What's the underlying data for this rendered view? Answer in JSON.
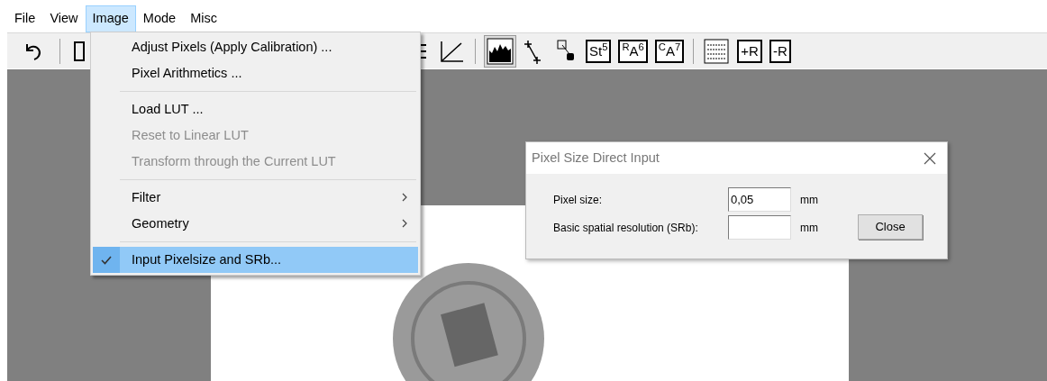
{
  "menu_bar": [
    {
      "label": "File",
      "selected": false
    },
    {
      "label": "View",
      "selected": false
    },
    {
      "label": "Image",
      "selected": true
    },
    {
      "label": "Mode",
      "selected": false
    },
    {
      "label": "Misc",
      "selected": false
    }
  ],
  "toolbar": [
    {
      "kind": "undo",
      "pressed": false
    },
    {
      "kind": "sep"
    },
    {
      "kind": "frame",
      "pressed": false
    },
    {
      "kind": "levels",
      "pressed": false
    },
    {
      "kind": "diagonal",
      "pressed": false
    },
    {
      "kind": "sep"
    },
    {
      "kind": "histogram",
      "pressed": true
    },
    {
      "kind": "measure",
      "pressed": false
    },
    {
      "kind": "point",
      "pressed": false
    },
    {
      "kind": "text",
      "label": "St$^{5}$",
      "pressed": false
    },
    {
      "kind": "text",
      "label": "$^{R}$A$^{6}$",
      "pressed": false
    },
    {
      "kind": "text",
      "label": "$^{C}$A$^{7}$",
      "pressed": false
    },
    {
      "kind": "sep"
    },
    {
      "kind": "list",
      "pressed": false
    },
    {
      "kind": "text",
      "label": "+R",
      "pressed": false
    },
    {
      "kind": "text",
      "label": "-R",
      "pressed": false
    }
  ],
  "image_menu": [
    {
      "kind": "item",
      "label": "Adjust Pixels (Apply Calibration) ...",
      "disabled": false,
      "checked": false,
      "selected": false
    },
    {
      "kind": "item",
      "label": "Pixel Arithmetics ...",
      "disabled": false,
      "checked": false,
      "selected": false
    },
    {
      "kind": "separator"
    },
    {
      "kind": "item",
      "label": "Load LUT ...",
      "disabled": false,
      "checked": false,
      "selected": false
    },
    {
      "kind": "item",
      "label": "Reset to Linear LUT",
      "disabled": true,
      "checked": false,
      "selected": false
    },
    {
      "kind": "item",
      "label": "Transform through the Current LUT",
      "disabled": true,
      "checked": false,
      "selected": false
    },
    {
      "kind": "separator"
    },
    {
      "kind": "submenu",
      "label": "Filter",
      "disabled": false,
      "checked": false,
      "selected": false
    },
    {
      "kind": "submenu",
      "label": "Geometry",
      "disabled": false,
      "checked": false,
      "selected": false
    },
    {
      "kind": "separator"
    },
    {
      "kind": "item",
      "label": "Input Pixelsize and SRb...",
      "disabled": false,
      "checked": true,
      "selected": true
    }
  ],
  "dialog": {
    "title": "Pixel Size Direct Input",
    "fields": [
      {
        "label": "Pixel size:",
        "value": "0,05",
        "unit": "mm"
      },
      {
        "label": "Basic spatial resolution (SRb):",
        "unit": "mm"
      }
    ],
    "button": "Close"
  }
}
